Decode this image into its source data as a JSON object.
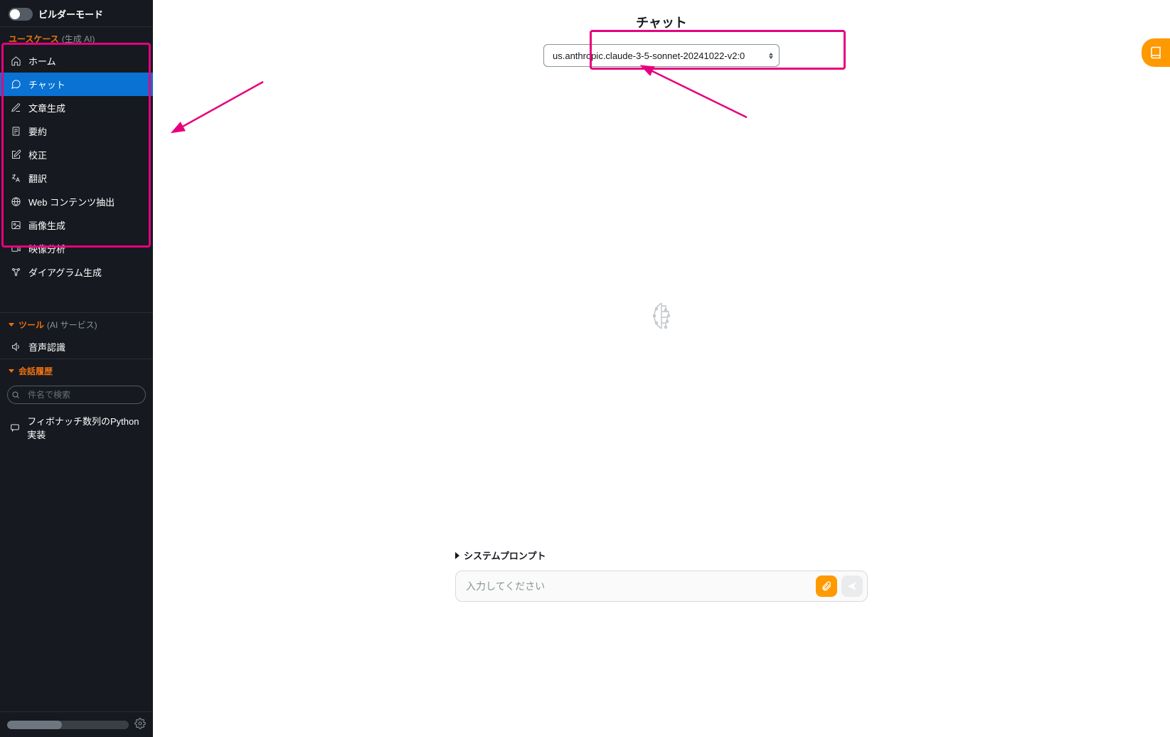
{
  "builder_mode_label": "ビルダーモード",
  "sections": {
    "usecase": {
      "title": "ユースケース",
      "sub": "(生成 AI)"
    },
    "tools": {
      "title": "ツール",
      "sub": "(AI サービス)"
    },
    "history": {
      "title": "会話履歴"
    }
  },
  "nav": {
    "home": "ホーム",
    "chat": "チャット",
    "text": "文章生成",
    "summary": "要約",
    "proof": "校正",
    "trans": "翻訳",
    "web": "Web コンテンツ抽出",
    "image": "画像生成",
    "video": "映像分析",
    "diagram": "ダイアグラム生成"
  },
  "tools": {
    "speech": "音声認識"
  },
  "history_search_placeholder": "件名で検索",
  "history_items": {
    "fib": "フィボナッチ数列のPython実装"
  },
  "page_title": "チャット",
  "model_selected": "us.anthropic.claude-3-5-sonnet-20241022-v2:0",
  "system_prompt_label": "システムプロンプト",
  "chat_input_placeholder": "入力してください",
  "colors": {
    "accent_orange": "#ff9900",
    "highlight_pink": "#e6007e",
    "sidebar_bg": "#16191f",
    "active_blue": "#0972d3"
  }
}
